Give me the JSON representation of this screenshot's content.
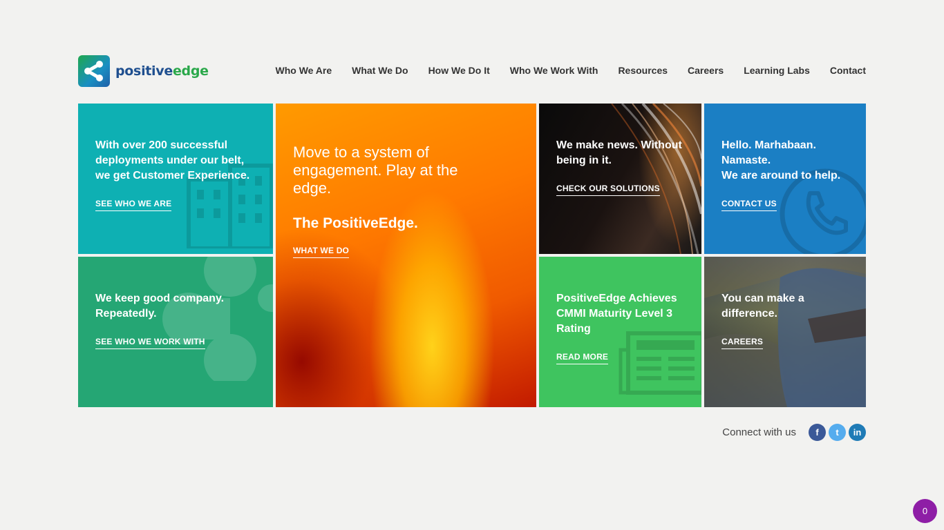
{
  "brand": {
    "name_part1": "positive",
    "name_part2": "edge"
  },
  "nav": {
    "items": [
      {
        "label": "Who We Are"
      },
      {
        "label": "What We Do"
      },
      {
        "label": "How We Do It"
      },
      {
        "label": "Who We Work With"
      },
      {
        "label": "Resources"
      },
      {
        "label": "Careers"
      },
      {
        "label": "Learning Labs"
      },
      {
        "label": "Contact"
      }
    ]
  },
  "tiles": {
    "who_we_are": {
      "text": "With over 200 successful deployments under our belt, we get Customer Experience.",
      "link": "SEE WHO WE ARE",
      "color": "#0eb0b3",
      "icon": "building-icon"
    },
    "work_with": {
      "text": "We keep good company. Repeatedly.",
      "link": "SEE WHO WE WORK WITH",
      "color": "#25a674",
      "icon": "network-icon"
    },
    "hero": {
      "title": "Move to a system of engagement. Play at the edge.",
      "subtitle": "The PositiveEdge.",
      "link": "WHAT WE DO"
    },
    "news": {
      "text": "We make news. Without being in it.",
      "link": "CHECK OUR SOLUTIONS"
    },
    "contact": {
      "text_line1": "Hello. Marhabaan. Namaste.",
      "text_line2": "We are around to help.",
      "link": "CONTACT US",
      "color": "#1b7fc4",
      "icon": "phone-icon"
    },
    "cmmi": {
      "text": "PositiveEdge Achieves CMMI Maturity Level 3 Rating",
      "link": "READ MORE",
      "color": "#3fc45f",
      "icon": "newspaper-icon"
    },
    "careers": {
      "text": "You can make a difference.",
      "link": "CAREERS"
    }
  },
  "footer": {
    "connect_label": "Connect with us",
    "social": [
      {
        "icon": "facebook-icon",
        "glyph": "f"
      },
      {
        "icon": "twitter-icon",
        "glyph": "t"
      },
      {
        "icon": "linkedin-icon",
        "glyph": "in"
      }
    ]
  },
  "badge": {
    "count": "0",
    "color": "#8e1ea6"
  }
}
